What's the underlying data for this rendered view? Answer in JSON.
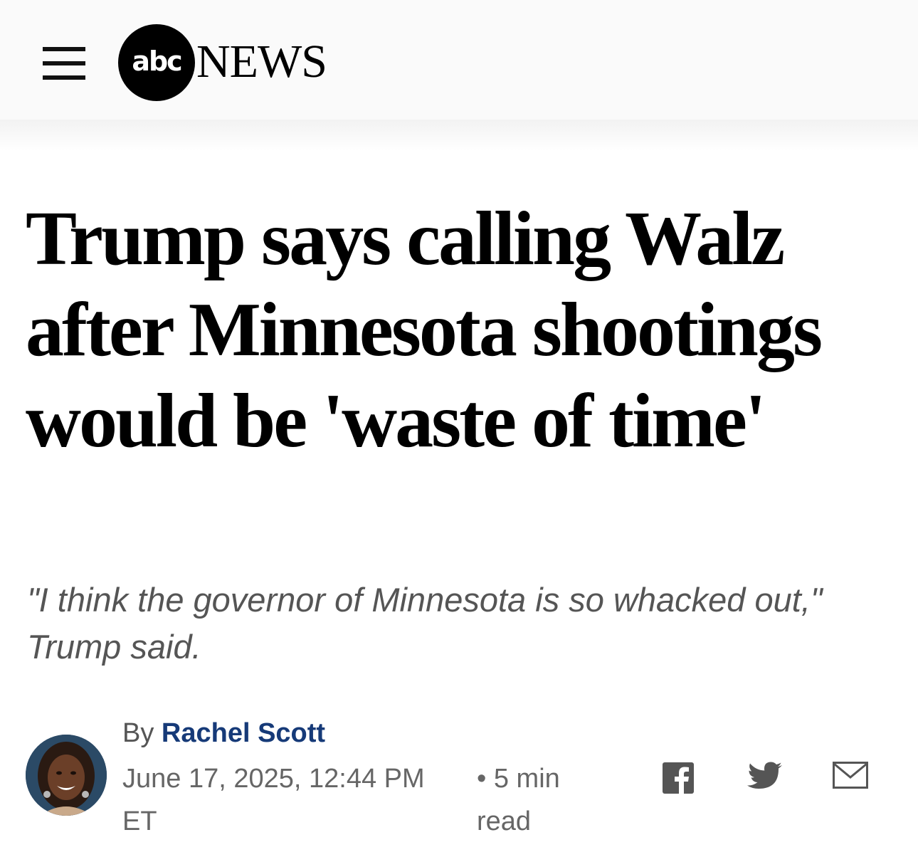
{
  "header": {
    "logo_abc": "abc",
    "logo_news": "NEWS"
  },
  "article": {
    "headline": "Trump says calling Walz after Minnesota shootings would be 'waste of time'",
    "subheadline": "\"I think the governor of Minnesota is so whacked out,\" Trump said.",
    "byline_prefix": "By ",
    "author": "Rachel Scott",
    "timestamp": "June 17, 2025, 12:44 PM ET",
    "read_time": "• 5 min read"
  },
  "share": {
    "icons": [
      "facebook-icon",
      "twitter-icon",
      "email-icon"
    ],
    "icon_color": "#555555"
  },
  "colors": {
    "author_link": "#163a78",
    "subhead": "#555555",
    "header_bg": "#fafafa"
  }
}
